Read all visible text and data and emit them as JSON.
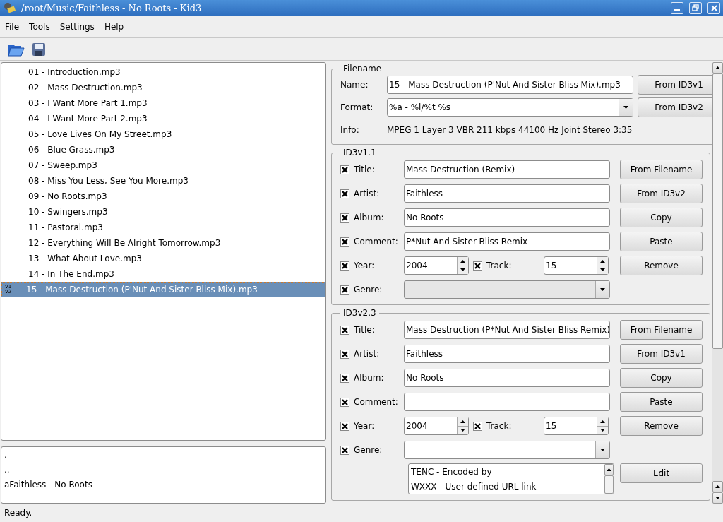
{
  "window": {
    "title": "/root/Music/Faithless - No Roots - Kid3"
  },
  "menu": [
    {
      "label": "File"
    },
    {
      "label": "Tools"
    },
    {
      "label": "Settings"
    },
    {
      "label": "Help"
    }
  ],
  "files": [
    {
      "name": "01 - Introduction.mp3",
      "selected": false
    },
    {
      "name": "02 - Mass Destruction.mp3",
      "selected": false
    },
    {
      "name": "03 - I Want More Part 1.mp3",
      "selected": false
    },
    {
      "name": "04 - I Want More Part 2.mp3",
      "selected": false
    },
    {
      "name": "05 - Love Lives On My Street.mp3",
      "selected": false
    },
    {
      "name": "06 - Blue Grass.mp3",
      "selected": false
    },
    {
      "name": "07 - Sweep.mp3",
      "selected": false
    },
    {
      "name": "08 - Miss You Less, See You More.mp3",
      "selected": false
    },
    {
      "name": "09 - No Roots.mp3",
      "selected": false
    },
    {
      "name": "10 - Swingers.mp3",
      "selected": false
    },
    {
      "name": "11 - Pastoral.mp3",
      "selected": false
    },
    {
      "name": "12 - Everything Will Be Alright Tomorrow.mp3",
      "selected": false
    },
    {
      "name": "13 - What About Love.mp3",
      "selected": false
    },
    {
      "name": "14 - In The End.mp3",
      "selected": false
    },
    {
      "name": "15 - Mass Destruction (P'Nut And Sister Bliss Mix).mp3",
      "selected": true,
      "tags": [
        "V1",
        "V2"
      ]
    }
  ],
  "dirs": [
    ".",
    "..",
    "aFaithless - No Roots"
  ],
  "filename": {
    "title": "Filename",
    "name_label": "Name:",
    "name_value": "15 - Mass Destruction (P'Nut And Sister Bliss Mix).mp3",
    "format_label": "Format:",
    "format_value": "%a - %l/%t %s",
    "info_label": "Info:",
    "info_value": "MPEG 1 Layer 3 VBR 211 kbps 44100 Hz Joint Stereo 3:35",
    "buttons": [
      "From ID3v1",
      "From ID3v2"
    ]
  },
  "tag_sections": [
    {
      "title": "ID3v1.1",
      "buttons": [
        "From Filename",
        "From ID3v2",
        "Copy",
        "Paste",
        "Remove"
      ],
      "rows": [
        {
          "kind": "text",
          "label": "Title:",
          "checked": true,
          "value": "Mass Destruction (Remix)"
        },
        {
          "kind": "text",
          "label": "Artist:",
          "checked": true,
          "value": "Faithless"
        },
        {
          "kind": "text",
          "label": "Album:",
          "checked": true,
          "value": "No Roots"
        },
        {
          "kind": "text",
          "label": "Comment:",
          "checked": true,
          "value": "P*Nut And Sister Bliss Remix"
        },
        {
          "kind": "spins",
          "label": "Year:",
          "checked": true,
          "value": "2004",
          "label2": "Track:",
          "checked2": true,
          "value2": "15"
        },
        {
          "kind": "combo",
          "label": "Genre:",
          "checked": true,
          "disabled": true
        }
      ]
    },
    {
      "title": "ID3v2.3",
      "buttons": [
        "From Filename",
        "From ID3v1",
        "Copy",
        "Paste",
        "Remove"
      ],
      "rows": [
        {
          "kind": "text",
          "label": "Title:",
          "checked": true,
          "value": "Mass Destruction (P*Nut And Sister Bliss Remix)"
        },
        {
          "kind": "text",
          "label": "Artist:",
          "checked": true,
          "value": "Faithless"
        },
        {
          "kind": "text",
          "label": "Album:",
          "checked": true,
          "value": "No Roots"
        },
        {
          "kind": "text",
          "label": "Comment:",
          "checked": true,
          "value": ""
        },
        {
          "kind": "spins",
          "label": "Year:",
          "checked": true,
          "value": "2004",
          "label2": "Track:",
          "checked2": true,
          "value2": "15"
        },
        {
          "kind": "combo",
          "label": "Genre:",
          "checked": true,
          "disabled": false
        }
      ],
      "frames": [
        "TENC - Encoded by",
        "WXXX - User defined URL link"
      ],
      "frame_buttons": [
        "Edit"
      ]
    }
  ],
  "status_bar": "Ready."
}
